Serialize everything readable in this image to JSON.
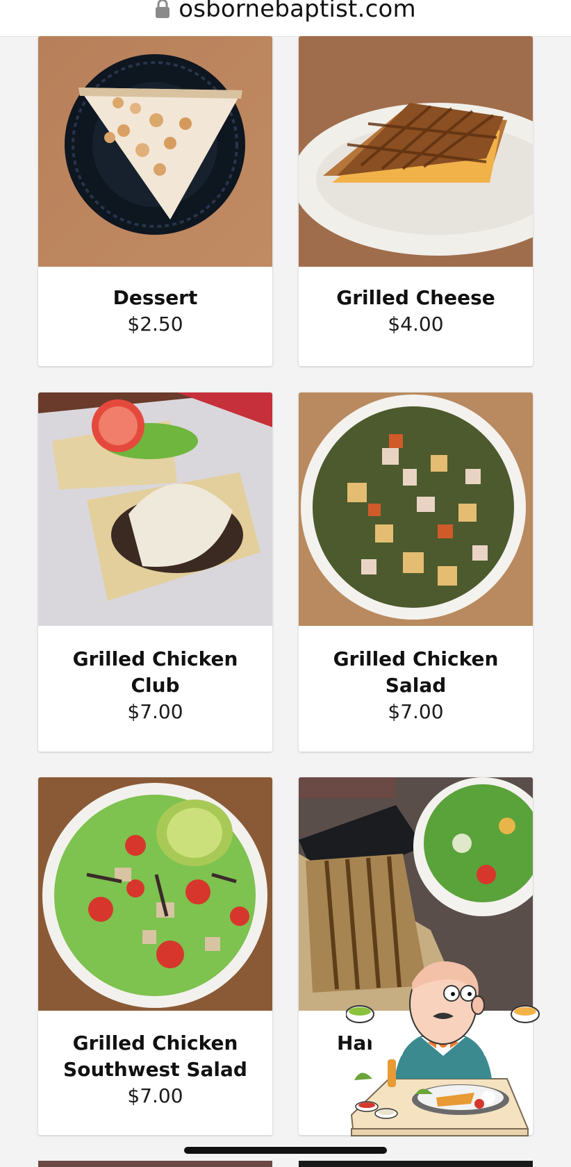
{
  "browser": {
    "url": "osbornebaptist.com"
  },
  "menu": {
    "items": [
      {
        "name": "Dessert",
        "price": "$2.50"
      },
      {
        "name": "Grilled Cheese",
        "price": "$4.00"
      },
      {
        "name": "Grilled Chicken Club",
        "price": "$7.00"
      },
      {
        "name": "Grilled Chicken Salad",
        "price": "$7.00"
      },
      {
        "name": "Grilled Chicken Southwest Salad",
        "price": "$7.00"
      },
      {
        "name": "Hal",
        "price": ""
      }
    ]
  },
  "colors": {
    "page_background": "#f3f3f3",
    "card_background": "#ffffff",
    "text": "#111111"
  },
  "overlay": {
    "icon": "chef-mascot-icon"
  }
}
